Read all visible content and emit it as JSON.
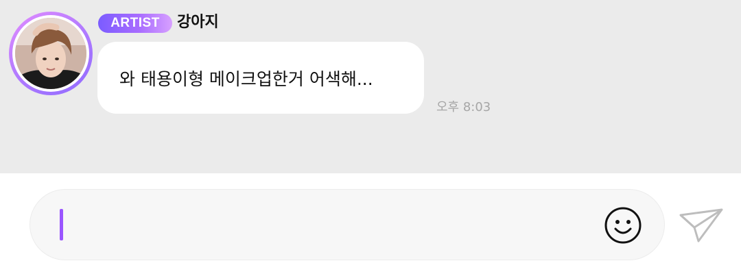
{
  "message": {
    "badge": "ARTIST",
    "sender": "강아지",
    "text": "와 태용이형 메이크업한거 어색해...",
    "time": "오후 8:03"
  },
  "composer": {
    "input_value": "",
    "emoji_icon": "smiley-face-icon",
    "send_icon": "paper-plane-send-icon"
  },
  "colors": {
    "chat_background": "#ebebeb",
    "accent_purple": "#9a55ff",
    "badge_gradient_start": "#7b5cff",
    "badge_gradient_end": "#d7a0ff"
  }
}
